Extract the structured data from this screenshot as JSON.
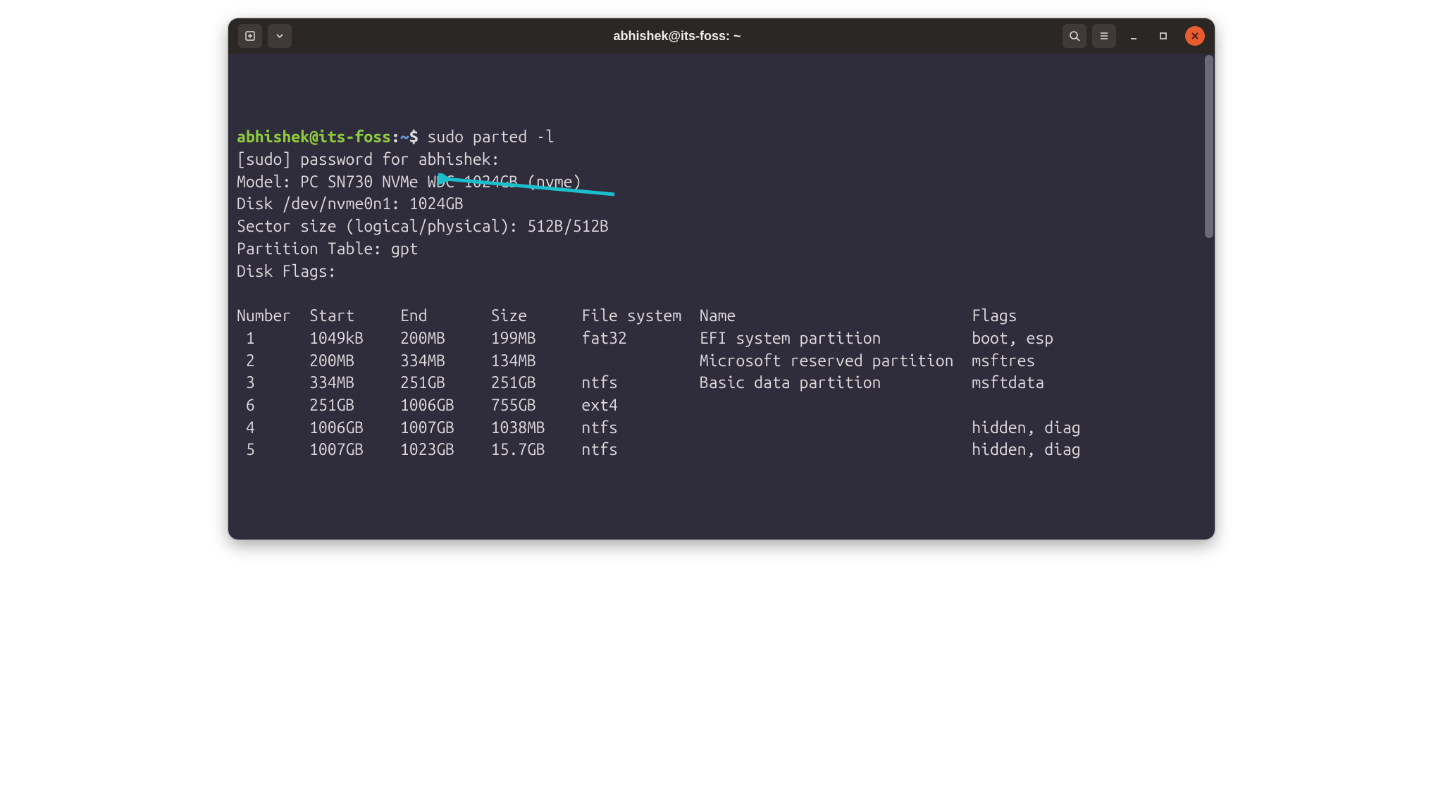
{
  "window_title": "abhishek@its-foss: ~",
  "prompt": {
    "user_host": "abhishek@its-foss",
    "sep": ":",
    "path": "~",
    "symbol": "$"
  },
  "command": "sudo parted -l",
  "output": {
    "sudo_line": "[sudo] password for abhishek: ",
    "model_line": "Model: PC SN730 NVMe WDC 1024GB (nvme)",
    "disk_line": "Disk /dev/nvme0n1: 1024GB",
    "sector_line": "Sector size (logical/physical): 512B/512B",
    "ptable_label": "Partition Table: ",
    "ptable_value": "gpt",
    "flags_line": "Disk Flags: "
  },
  "columns": {
    "number": "Number",
    "start": "Start",
    "end": "End",
    "size": "Size",
    "fs": "File system",
    "name": "Name",
    "flags": "Flags"
  },
  "rows": [
    {
      "number": "1",
      "start": "1049kB",
      "end": "200MB",
      "size": "199MB",
      "fs": "fat32",
      "name": "EFI system partition",
      "flags": "boot, esp"
    },
    {
      "number": "2",
      "start": "200MB",
      "end": "334MB",
      "size": "134MB",
      "fs": "",
      "name": "Microsoft reserved partition",
      "flags": "msftres"
    },
    {
      "number": "3",
      "start": "334MB",
      "end": "251GB",
      "size": "251GB",
      "fs": "ntfs",
      "name": "Basic data partition",
      "flags": "msftdata"
    },
    {
      "number": "6",
      "start": "251GB",
      "end": "1006GB",
      "size": "755GB",
      "fs": "ext4",
      "name": "",
      "flags": ""
    },
    {
      "number": "4",
      "start": "1006GB",
      "end": "1007GB",
      "size": "1038MB",
      "fs": "ntfs",
      "name": "",
      "flags": "hidden, diag"
    },
    {
      "number": "5",
      "start": "1007GB",
      "end": "1023GB",
      "size": "15.7GB",
      "fs": "ntfs",
      "name": "",
      "flags": "hidden, diag"
    }
  ],
  "colors": {
    "arrow": "#1bbecb"
  }
}
